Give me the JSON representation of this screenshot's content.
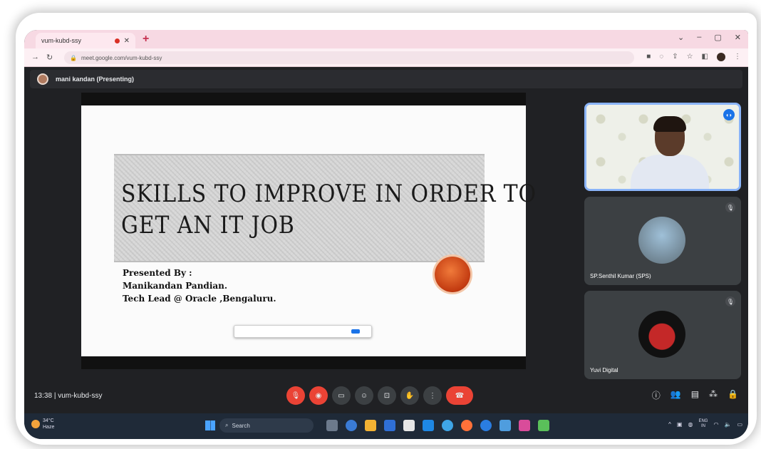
{
  "browser": {
    "tab_title": "vum-kubd-ssy",
    "url": "meet.google.com/vum-kubd-ssy"
  },
  "meet": {
    "presenting_label": "mani kandan (Presenting)",
    "meeting_time": "13:38",
    "meeting_code": "vum-kubd-ssy",
    "participants": [
      {
        "name": "SP.Senthil Kumar (SPS)"
      },
      {
        "name": "Yuvi Digital"
      }
    ]
  },
  "slide": {
    "title_line1": "SKILLS TO IMPROVE IN ORDER TO",
    "title_line2": "GET AN IT JOB",
    "presented_by": "Presented By :",
    "presenter_name": "Manikandan Pandian.",
    "presenter_role": "Tech Lead @ Oracle ,Bengaluru."
  },
  "taskbar": {
    "weather_temp": "34°C",
    "weather_desc": "Haze",
    "search_placeholder": "Search",
    "lang": "ENG",
    "lang_region": "IN"
  },
  "colors": {
    "meet_bg": "#202124",
    "end_call": "#ea4335",
    "active_speaker": "#8ab4f8"
  }
}
